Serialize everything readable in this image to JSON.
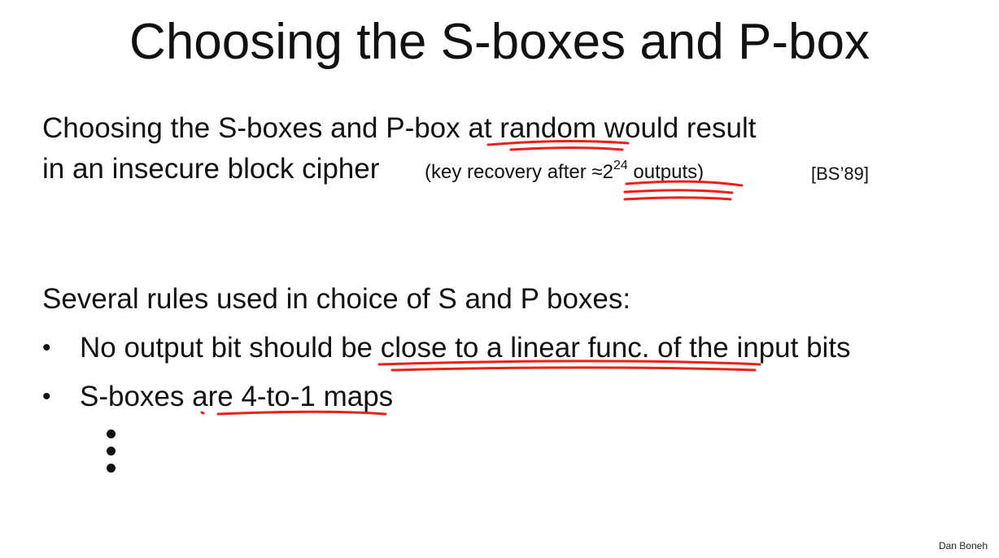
{
  "slide": {
    "title": "Choosing the S-boxes and P-box",
    "intro": {
      "line1_before": "Choosing the S-boxes and P-box ",
      "line1_highlight": "at random",
      "line1_after": " would result",
      "line2": "in an insecure block cipher",
      "aside_before": "(key recovery after ",
      "aside_highlight": "≈2",
      "aside_exponent": "24",
      "aside_after": " outputs)",
      "citation": "[BS’89]"
    },
    "rules_heading": "Several rules used in choice of S and P boxes:",
    "rules": [
      {
        "bullet": "•",
        "before": "No output bit should ",
        "highlight": "be close to a linear func. of the",
        "after": " input bits"
      },
      {
        "bullet": "•",
        "before": "S-boxes are ",
        "highlight": "4-to-1 maps",
        "after": ""
      }
    ],
    "footer": "Dan Boneh"
  },
  "annotations": {
    "ink_color": "#e8221b"
  }
}
